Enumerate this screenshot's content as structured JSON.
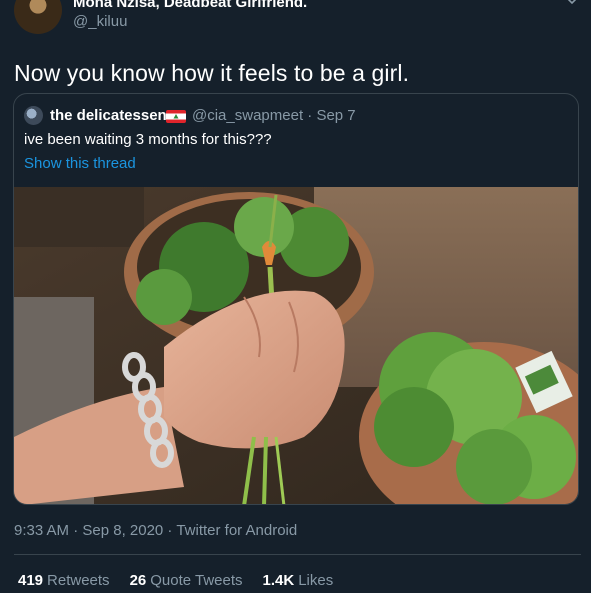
{
  "author": {
    "name": "Mona Nzisa, Deadbeat Girlfriend.",
    "handle": "@_kiluu"
  },
  "tweet": {
    "text": "Now you know how it feels to be a girl."
  },
  "quoted": {
    "name": "the delicatessen",
    "handle_date": "@cia_swapmeet · Sep 7",
    "text": "ive been waiting 3 months for this???",
    "thread_link": "Show this thread"
  },
  "meta": {
    "timestamp": "9:33 AM · Sep 8, 2020 · Twitter for Android"
  },
  "stats": {
    "retweets_count": "419",
    "retweets_label": "Retweets",
    "quotes_count": "26",
    "quotes_label": "Quote Tweets",
    "likes_count": "1.4K",
    "likes_label": "Likes"
  },
  "colors": {
    "background": "#15202b",
    "secondary_text": "#8899a6",
    "link": "#1b95e0",
    "border": "#38444d"
  }
}
